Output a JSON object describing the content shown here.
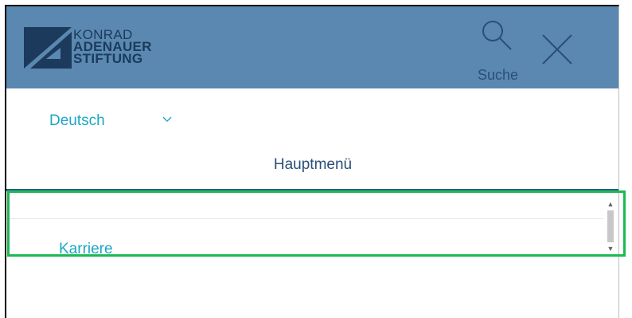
{
  "header": {
    "logo": {
      "line1": "KONRAD",
      "line2": "ADENAUER",
      "line3": "STIFTUNG"
    },
    "search_label": "Suche"
  },
  "menu": {
    "language_label": "Deutsch",
    "main_menu_title": "Hauptmenü",
    "items": [
      {
        "label": "Karriere"
      }
    ]
  },
  "colors": {
    "header_bg": "#5b88b0",
    "accent_cyan": "#1aa7c4",
    "dark_blue": "#2a4f78",
    "highlight_green": "#1db954"
  }
}
